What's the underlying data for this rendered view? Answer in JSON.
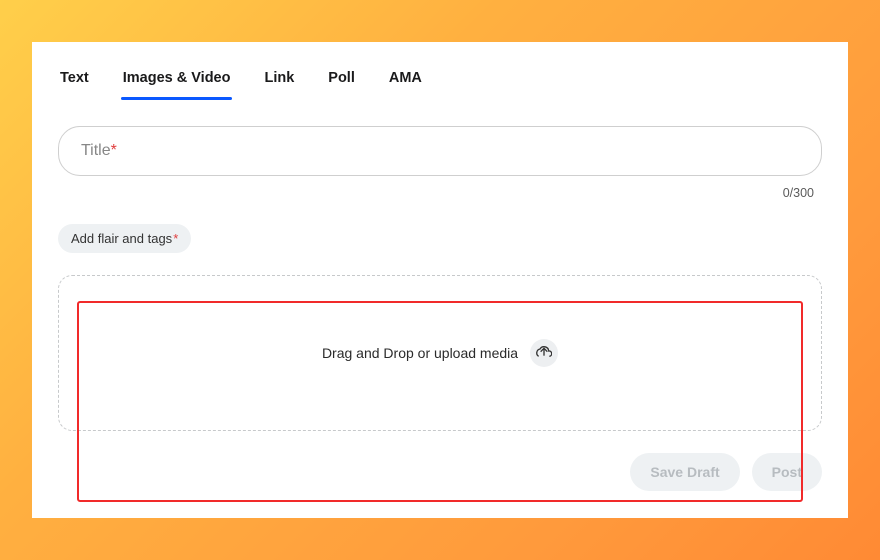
{
  "tabs": {
    "text": {
      "label": "Text"
    },
    "images": {
      "label": "Images & Video",
      "active": true
    },
    "link": {
      "label": "Link"
    },
    "poll": {
      "label": "Poll"
    },
    "ama": {
      "label": "AMA"
    }
  },
  "title": {
    "placeholder_base": "Title",
    "required_marker": "*",
    "counter": "0/300"
  },
  "flair": {
    "label": "Add flair and tags",
    "required_marker": "*"
  },
  "drop": {
    "label": "Drag and Drop or upload media"
  },
  "buttons": {
    "save_draft": "Save Draft",
    "post": "Post"
  }
}
